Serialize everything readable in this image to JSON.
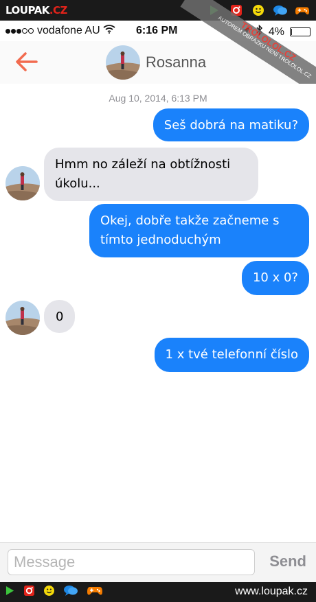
{
  "site": {
    "logo_main": "LOUPAK",
    "logo_suffix": ".CZ",
    "url": "www.loupak.cz",
    "icons": [
      "play-icon",
      "instagram-icon",
      "smiley-icon",
      "chat-icon",
      "gamepad-icon"
    ]
  },
  "status_bar": {
    "carrier": "vodafone AU",
    "time": "6:16 PM",
    "battery": "4%",
    "battery_level": 0.04
  },
  "watermark": {
    "brand": "TROLOLOL.CZ",
    "note": "AUTOREM OBRÁZKU NENÍ TROLOLOL.CZ"
  },
  "header": {
    "contact_name": "Rosanna"
  },
  "conversation": {
    "timestamp": "Aug 10, 2014, 6:13 PM",
    "messages": [
      {
        "direction": "outgoing",
        "text": "Seš dobrá na matiku?"
      },
      {
        "direction": "incoming",
        "text": "Hmm no záleží na obtížnosti úkolu..."
      },
      {
        "direction": "outgoing",
        "text": "Okej, dobře takže začneme s tímto jednoduchým"
      },
      {
        "direction": "outgoing",
        "text": "10 x 0?"
      },
      {
        "direction": "incoming",
        "text": "0"
      },
      {
        "direction": "outgoing",
        "text": "1 x tvé telefonní číslo"
      }
    ]
  },
  "composer": {
    "placeholder": "Message",
    "send_label": "Send"
  },
  "colors": {
    "accent": "#f26b4f",
    "outgoing_bubble": "#1a82fb",
    "incoming_bubble": "#e5e5ea",
    "bar": "#1a1a1a"
  }
}
